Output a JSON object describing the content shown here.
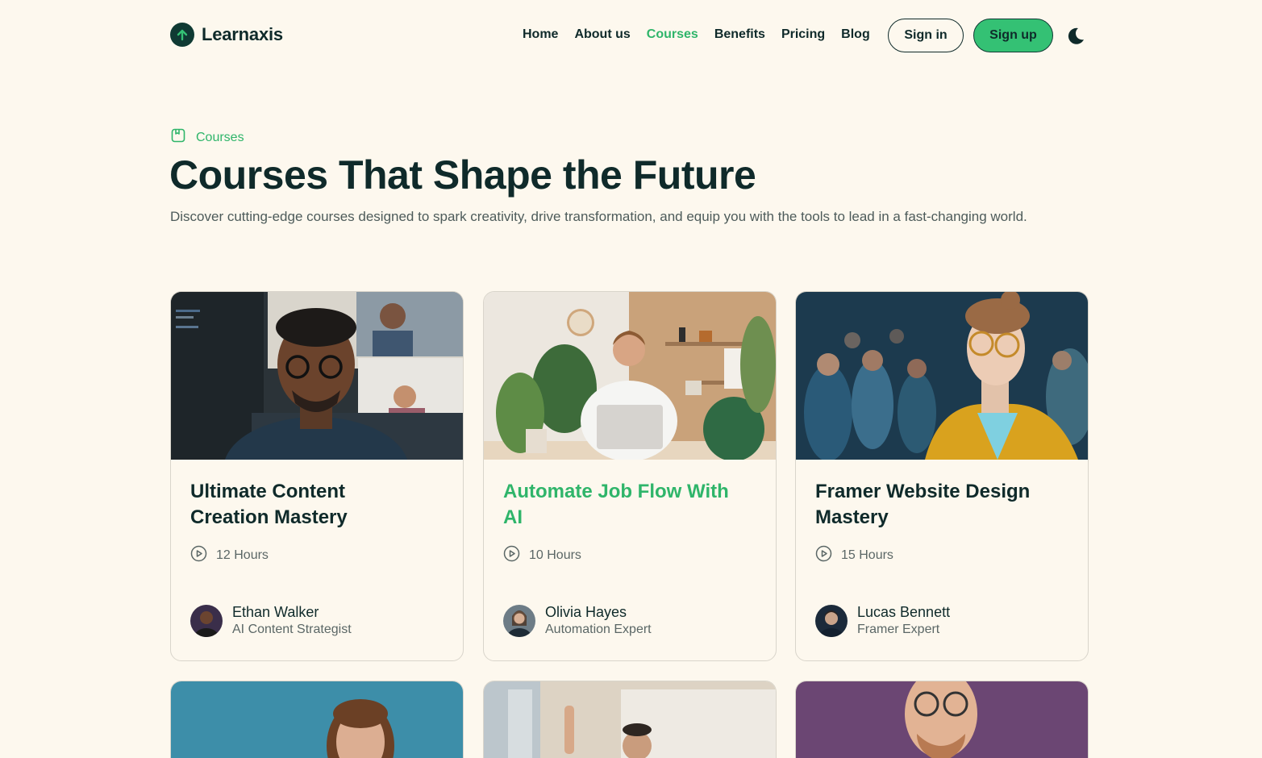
{
  "brand": {
    "name": "Learnaxis"
  },
  "nav": {
    "items": [
      {
        "label": "Home"
      },
      {
        "label": "About us"
      },
      {
        "label": "Courses",
        "active": true
      },
      {
        "label": "Benefits"
      },
      {
        "label": "Pricing"
      },
      {
        "label": "Blog"
      }
    ],
    "signin_label": "Sign in",
    "signup_label": "Sign up",
    "theme_icon": "moon-icon"
  },
  "hero": {
    "eyebrow": "Courses",
    "title": "Courses That Shape the Future",
    "description": "Discover cutting-edge courses designed to spark creativity, drive transformation, and equip you with the tools to lead in a fast-changing world."
  },
  "courses": [
    {
      "title": "Ultimate Content Creation Mastery",
      "duration": "12 Hours",
      "instructor": "Ethan Walker",
      "role": "AI Content Strategist"
    },
    {
      "title": "Automate Job Flow With AI",
      "duration": "10 Hours",
      "instructor": "Olivia Hayes",
      "role": "Automation Expert"
    },
    {
      "title": "Framer Website Design Mastery",
      "duration": "15 Hours",
      "instructor": "Lucas Bennett",
      "role": "Framer Expert"
    }
  ],
  "colors": {
    "accent": "#2fb56a",
    "background": "#fdf8ee",
    "text": "#0f2a2a"
  }
}
